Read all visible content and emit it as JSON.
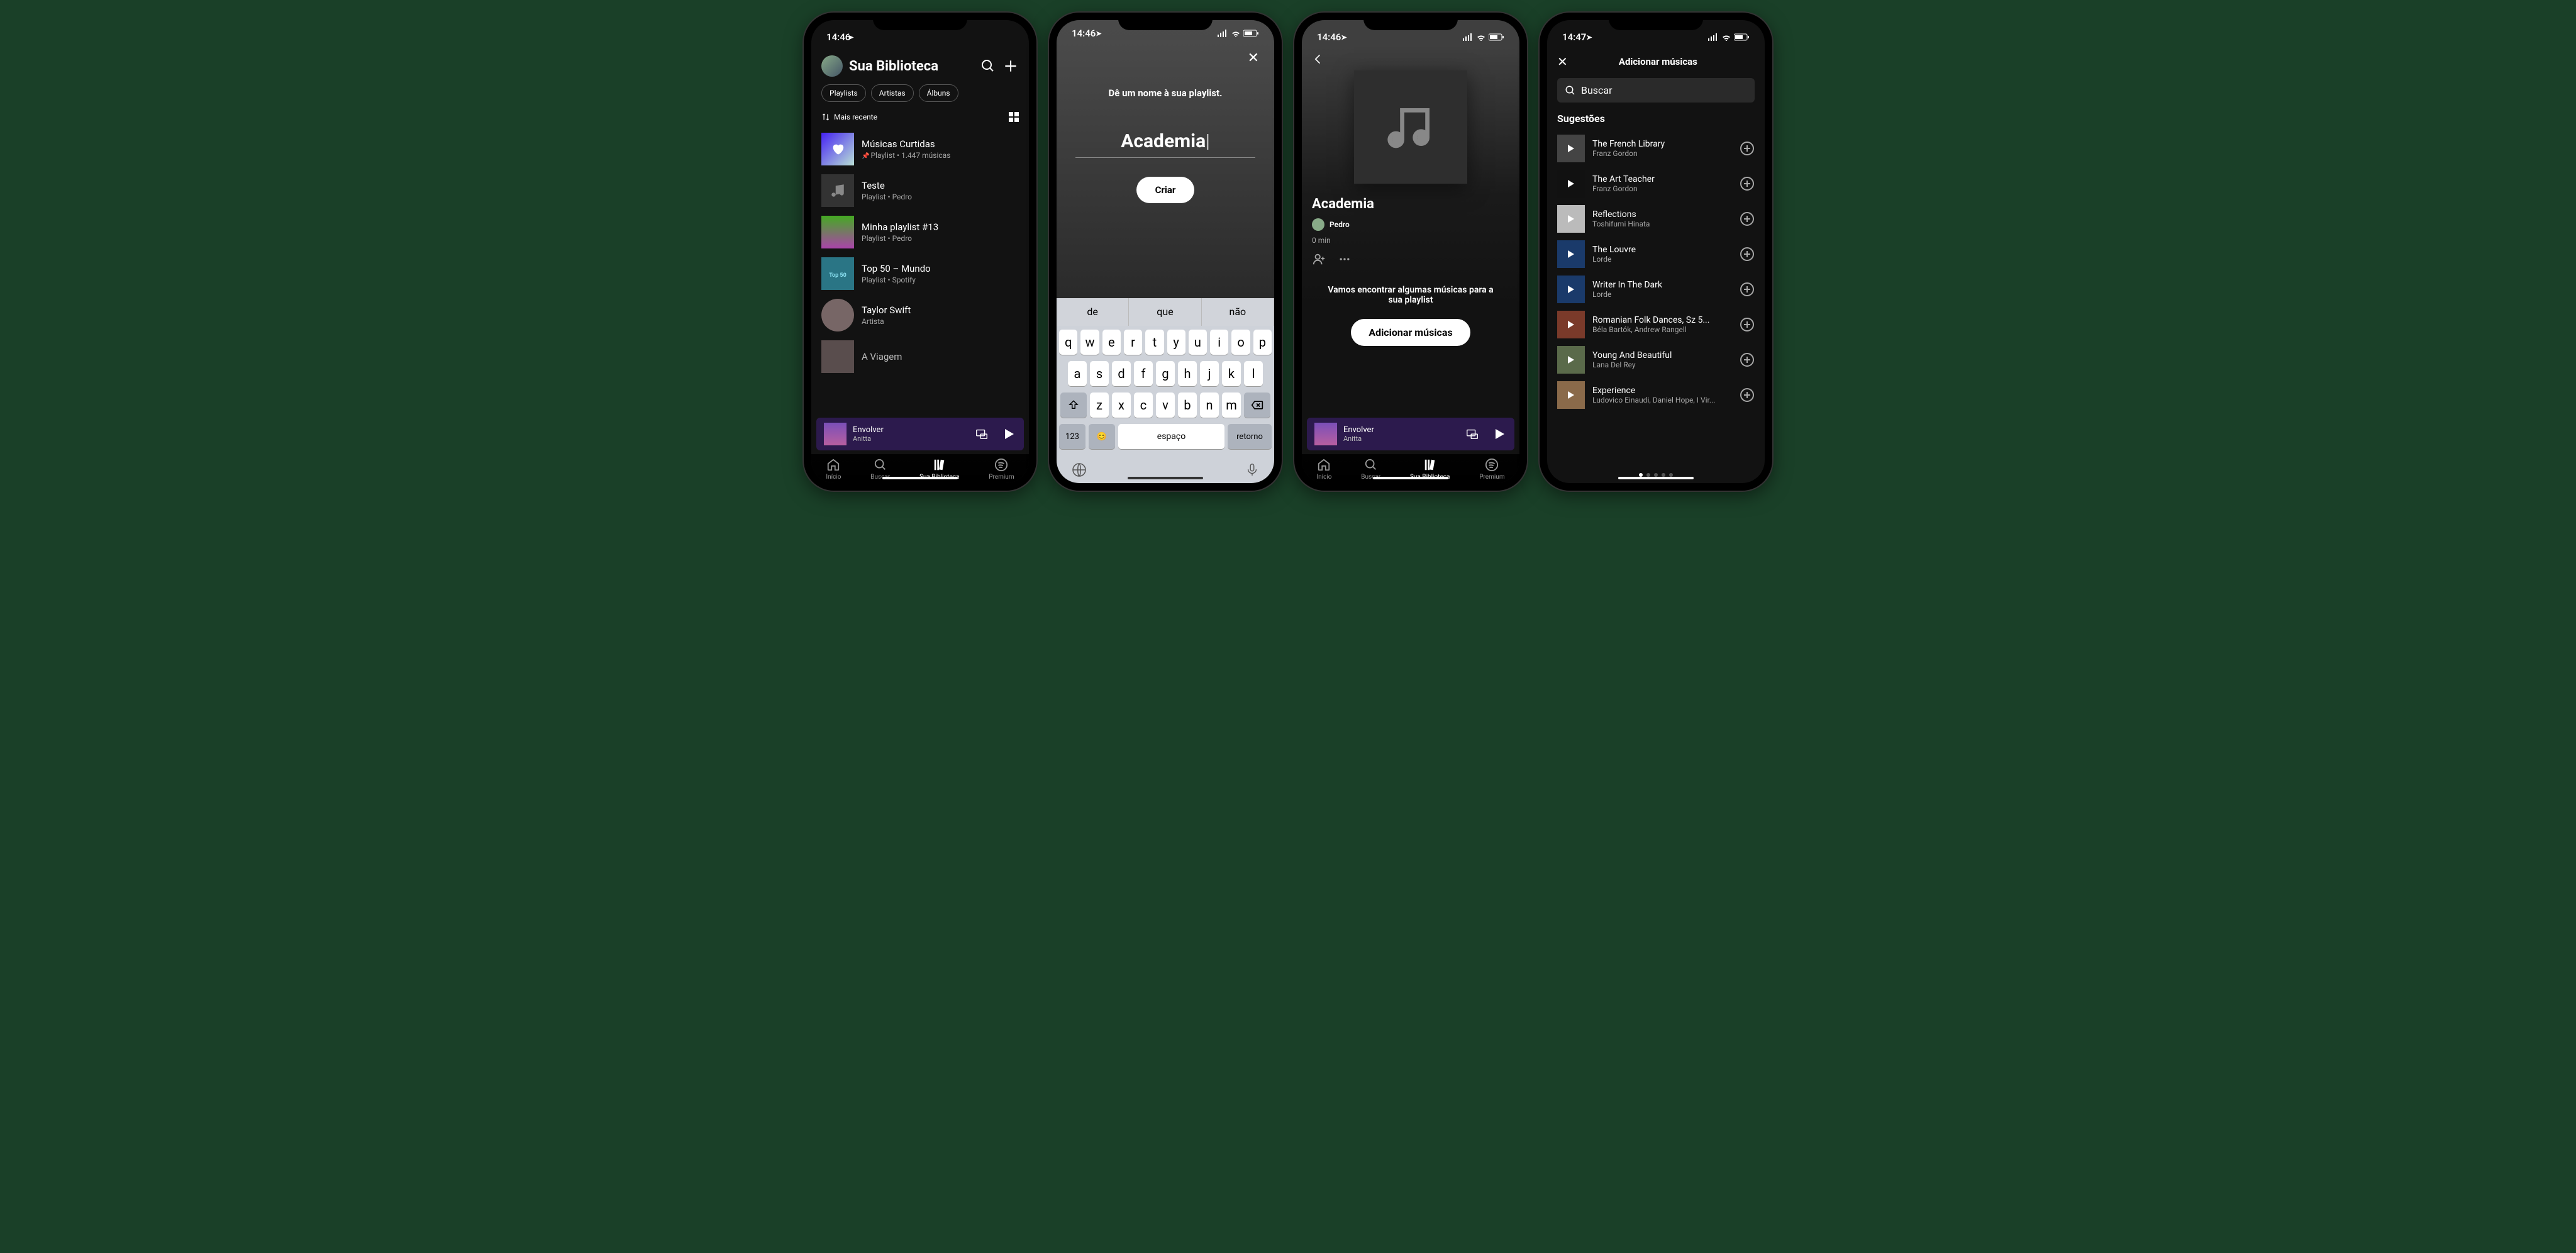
{
  "statusbar": {
    "time1": "14:46",
    "time4": "14:47"
  },
  "library": {
    "title": "Sua Biblioteca",
    "chips": [
      "Playlists",
      "Artistas",
      "Álbuns"
    ],
    "sort": "Mais recente",
    "items": [
      {
        "title": "Músicas Curtidas",
        "sub": "Playlist • 1.447 músicas",
        "pinned": true,
        "type": "liked"
      },
      {
        "title": "Teste",
        "sub": "Playlist • Pedro",
        "type": "note"
      },
      {
        "title": "Minha playlist #13",
        "sub": "Playlist • Pedro",
        "type": "img"
      },
      {
        "title": "Top 50 – Mundo",
        "sub": "Playlist • Spotify",
        "type": "top50"
      },
      {
        "title": "Taylor Swift",
        "sub": "Artista",
        "type": "artist"
      },
      {
        "title": "A Viagem",
        "sub": "",
        "type": "img"
      }
    ]
  },
  "nowplaying": {
    "title": "Envolver",
    "artist": "Anitta"
  },
  "tabs": {
    "home": "Início",
    "search": "Buscar",
    "library": "Sua Biblioteca",
    "premium": "Premium"
  },
  "create": {
    "prompt": "Dê um nome à sua playlist.",
    "value": "Academia",
    "button": "Criar",
    "predict": [
      "de",
      "que",
      "não"
    ],
    "row1": [
      "q",
      "w",
      "e",
      "r",
      "t",
      "y",
      "u",
      "i",
      "o",
      "p"
    ],
    "row2": [
      "a",
      "s",
      "d",
      "f",
      "g",
      "h",
      "j",
      "k",
      "l"
    ],
    "row3": [
      "z",
      "x",
      "c",
      "v",
      "b",
      "n",
      "m"
    ],
    "space": "espaço",
    "ret": "retorno",
    "num": "123"
  },
  "playlist": {
    "title": "Academia",
    "owner": "Pedro",
    "duration": "0 min",
    "message": "Vamos encontrar algumas músicas para a sua playlist",
    "button": "Adicionar músicas"
  },
  "addsongs": {
    "title": "Adicionar músicas",
    "search": "Buscar",
    "section": "Sugestões",
    "items": [
      {
        "title": "The French Library",
        "sub": "Franz Gordon"
      },
      {
        "title": "The Art Teacher",
        "sub": "Franz Gordon"
      },
      {
        "title": "Reflections",
        "sub": "Toshifumi Hinata"
      },
      {
        "title": "The Louvre",
        "sub": "Lorde"
      },
      {
        "title": "Writer In The Dark",
        "sub": "Lorde"
      },
      {
        "title": "Romanian Folk Dances, Sz 5...",
        "sub": "Béla Bartók, Andrew Rangell"
      },
      {
        "title": "Young And Beautiful",
        "sub": "Lana Del Rey"
      },
      {
        "title": "Experience",
        "sub": "Ludovico Einaudi, Daniel Hope, I Vir..."
      }
    ]
  }
}
